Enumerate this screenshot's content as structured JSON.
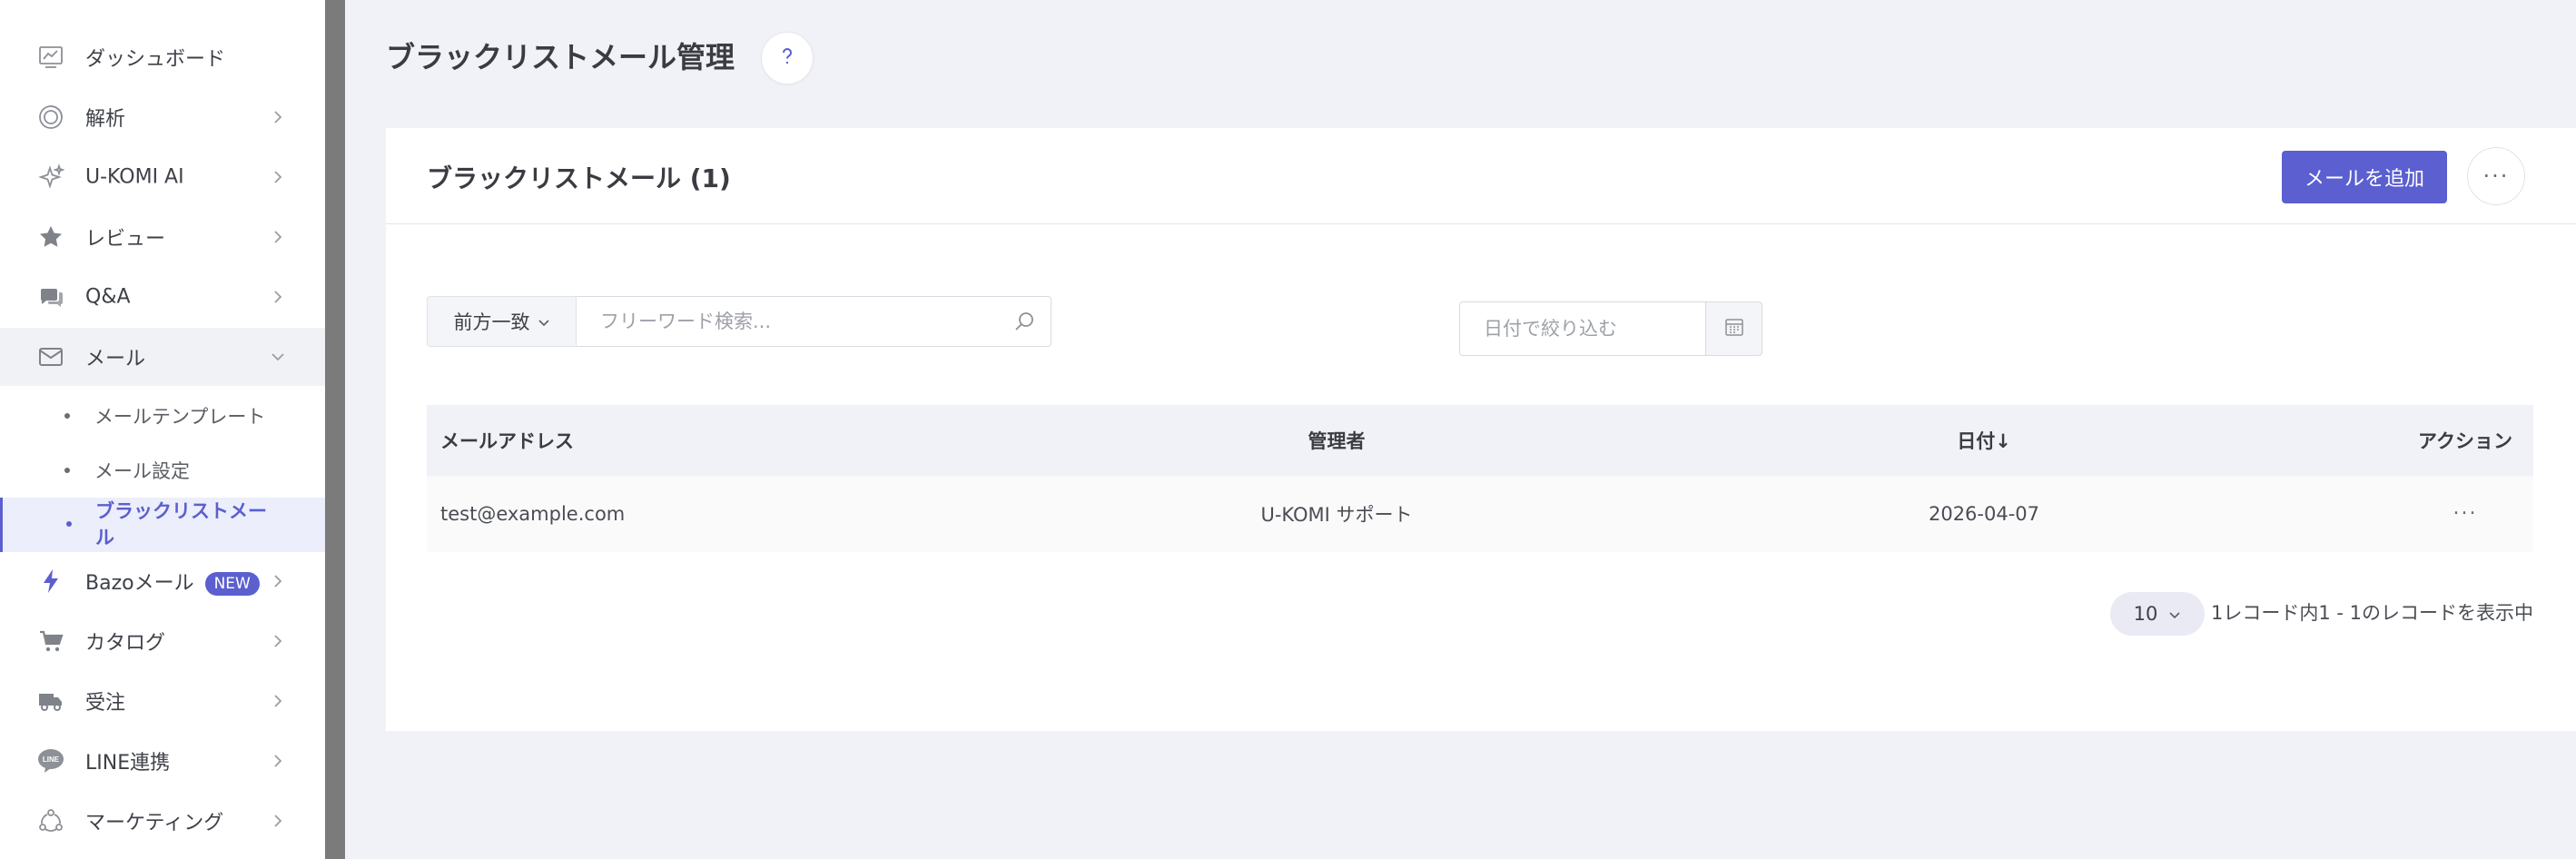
{
  "sidebar": {
    "items": [
      {
        "label": "ダッシュボード",
        "icon": "dashboard-icon",
        "chevron": ""
      },
      {
        "label": "解析",
        "icon": "analytics-icon",
        "chevron": "right"
      },
      {
        "label": "U-KOMI AI",
        "icon": "sparkle-icon",
        "chevron": "right"
      },
      {
        "label": "レビュー",
        "icon": "star-icon",
        "chevron": "right"
      },
      {
        "label": "Q&A",
        "icon": "chat-icon",
        "chevron": "right"
      },
      {
        "label": "メール",
        "icon": "mail-icon",
        "chevron": "down"
      },
      {
        "label": "Bazoメール",
        "icon": "lightning-icon",
        "chevron": "right",
        "badge": "NEW"
      },
      {
        "label": "カタログ",
        "icon": "cart-icon",
        "chevron": "right"
      },
      {
        "label": "受注",
        "icon": "truck-icon",
        "chevron": "right"
      },
      {
        "label": "LINE連携",
        "icon": "line-icon",
        "chevron": "right"
      },
      {
        "label": "マーケティング",
        "icon": "marketing-icon",
        "chevron": "right"
      }
    ],
    "mail_submenu": [
      {
        "label": "メールテンプレート"
      },
      {
        "label": "メール設定"
      },
      {
        "label": "ブラックリストメール",
        "active": true
      }
    ]
  },
  "page": {
    "title": "ブラックリストメール管理"
  },
  "card": {
    "title": "ブラックリストメール (1)",
    "add_button": "メールを追加",
    "more_button": "···"
  },
  "filters": {
    "match_mode": "前方一致",
    "search_placeholder": "フリーワード検索...",
    "date_placeholder": "日付で絞り込む"
  },
  "table": {
    "columns": [
      "メールアドレス",
      "管理者",
      "日付↓",
      "アクション"
    ],
    "rows": [
      {
        "email": "test@example.com",
        "admin": "U-KOMI サポート",
        "date": "2026-04-07",
        "action": "···"
      }
    ]
  },
  "pagination": {
    "page_size": "10",
    "info": "1レコード内1 - 1のレコードを表示中"
  },
  "colors": {
    "accent": "#5b5fcf",
    "background": "#f1f2f7",
    "sidebar_active_bg": "#eceefb"
  }
}
